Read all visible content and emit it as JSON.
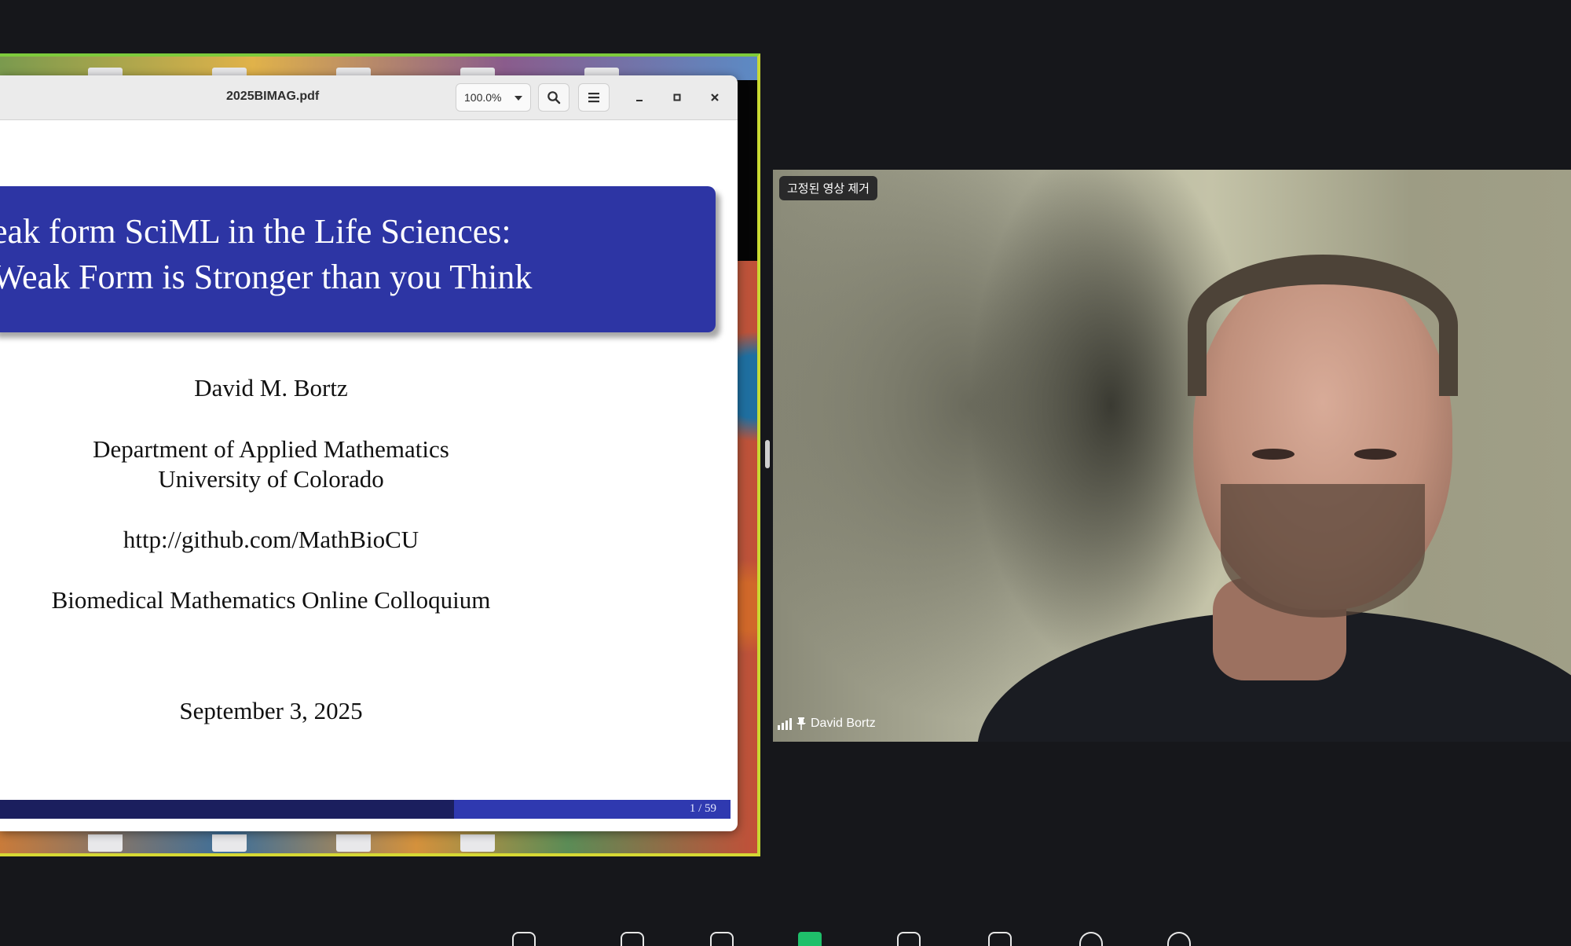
{
  "shared_screen": {
    "document_title": "2025BIMAG.pdf",
    "zoom_level": "100.0%",
    "toolbar": {
      "search_icon": "search-icon",
      "menu_icon": "hamburger-menu-icon",
      "minimize_icon": "minimize-icon",
      "maximize_icon": "maximize-icon",
      "close_icon": "close-icon"
    },
    "slide": {
      "title_line_1": "eak form SciML in the Life Sciences:",
      "title_line_2": "Weak Form is Stronger than you Think",
      "author": "David M. Bortz",
      "department": "Department of Applied Mathematics",
      "university": "University of Colorado",
      "url": "http://github.com/MathBioCU",
      "event": "Biomedical Mathematics Online Colloquium",
      "date": "September 3, 2025",
      "page_indicator": "1 / 59",
      "title_color": "#2d35a4"
    }
  },
  "video": {
    "pinned_badge": "고정된 영상 제거",
    "participant_name": "David Bortz",
    "signal_icon": "signal-strength-icon",
    "pin_icon": "pin-icon"
  },
  "colors": {
    "background": "#16171b",
    "share_border": "#7ecb3c"
  }
}
